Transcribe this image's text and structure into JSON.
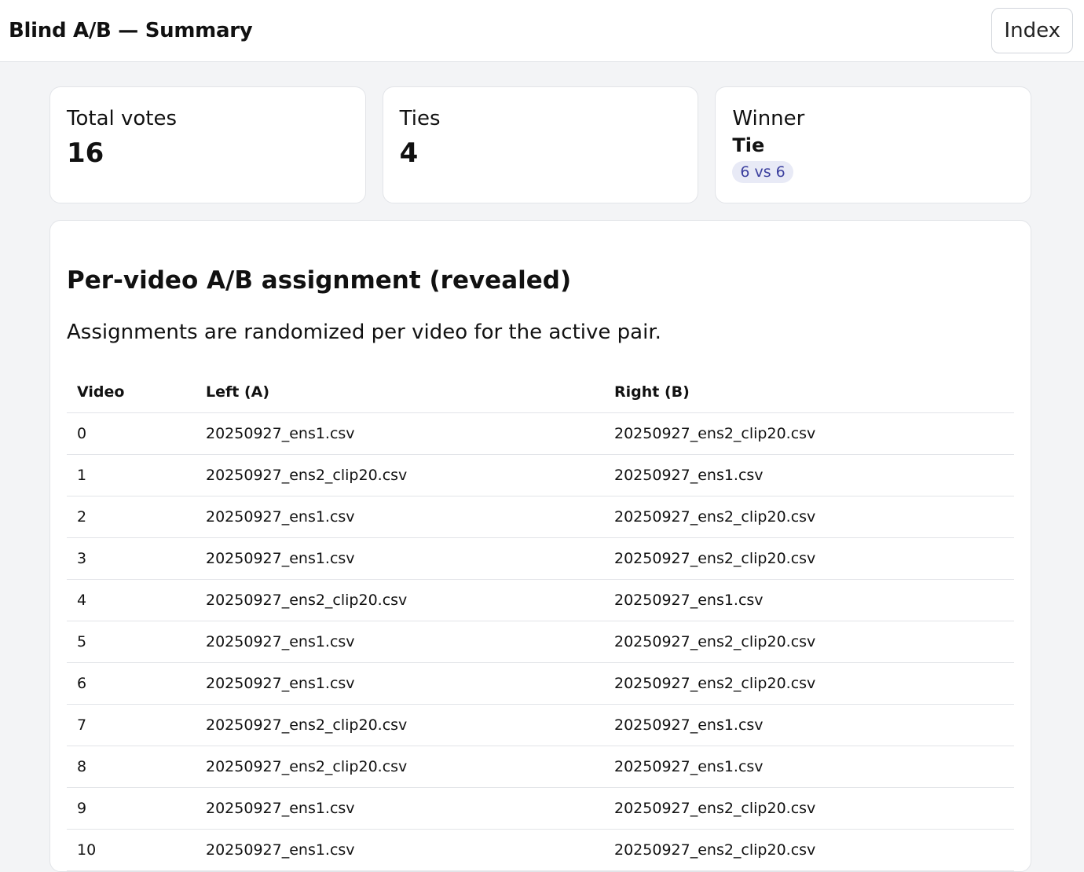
{
  "header": {
    "title": "Blind A/B — Summary",
    "index_label": "Index"
  },
  "stats": {
    "total_votes_label": "Total votes",
    "total_votes_value": "16",
    "ties_label": "Ties",
    "ties_value": "4",
    "winner_label": "Winner",
    "winner_value": "Tie",
    "winner_badge": "6 vs 6"
  },
  "assignments": {
    "title": "Per-video A/B assignment (revealed)",
    "description": "Assignments are randomized per video for the active pair.",
    "columns": [
      "Video",
      "Left (A)",
      "Right (B)"
    ],
    "rows": [
      {
        "video": "0",
        "left": "20250927_ens1.csv",
        "right": "20250927_ens2_clip20.csv"
      },
      {
        "video": "1",
        "left": "20250927_ens2_clip20.csv",
        "right": "20250927_ens1.csv"
      },
      {
        "video": "2",
        "left": "20250927_ens1.csv",
        "right": "20250927_ens2_clip20.csv"
      },
      {
        "video": "3",
        "left": "20250927_ens1.csv",
        "right": "20250927_ens2_clip20.csv"
      },
      {
        "video": "4",
        "left": "20250927_ens2_clip20.csv",
        "right": "20250927_ens1.csv"
      },
      {
        "video": "5",
        "left": "20250927_ens1.csv",
        "right": "20250927_ens2_clip20.csv"
      },
      {
        "video": "6",
        "left": "20250927_ens1.csv",
        "right": "20250927_ens2_clip20.csv"
      },
      {
        "video": "7",
        "left": "20250927_ens2_clip20.csv",
        "right": "20250927_ens1.csv"
      },
      {
        "video": "8",
        "left": "20250927_ens2_clip20.csv",
        "right": "20250927_ens1.csv"
      },
      {
        "video": "9",
        "left": "20250927_ens1.csv",
        "right": "20250927_ens2_clip20.csv"
      },
      {
        "video": "10",
        "left": "20250927_ens1.csv",
        "right": "20250927_ens2_clip20.csv"
      }
    ]
  }
}
